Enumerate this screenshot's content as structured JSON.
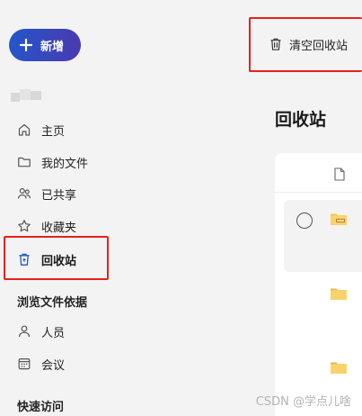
{
  "sidebar": {
    "new_button_label": "新增",
    "nav": [
      {
        "label": "主页",
        "icon": "home-icon"
      },
      {
        "label": "我的文件",
        "icon": "folder-icon"
      },
      {
        "label": "已共享",
        "icon": "people-icon"
      },
      {
        "label": "收藏夹",
        "icon": "star-icon"
      },
      {
        "label": "回收站",
        "icon": "recycle-bin-icon",
        "active": true
      }
    ],
    "browse_section_title": "浏览文件依据",
    "browse_items": [
      {
        "label": "人员",
        "icon": "person-icon"
      },
      {
        "label": "会议",
        "icon": "calendar-icon"
      }
    ],
    "quick_access_title": "快速访问"
  },
  "toolbar": {
    "empty_recycle_bin_label": "清空回收站"
  },
  "main": {
    "title": "回收站"
  },
  "watermark": "CSDN @学点儿啥",
  "colors": {
    "accent": "#2456c9",
    "highlight_box": "#e8211b",
    "folder": "#f5c64a"
  }
}
